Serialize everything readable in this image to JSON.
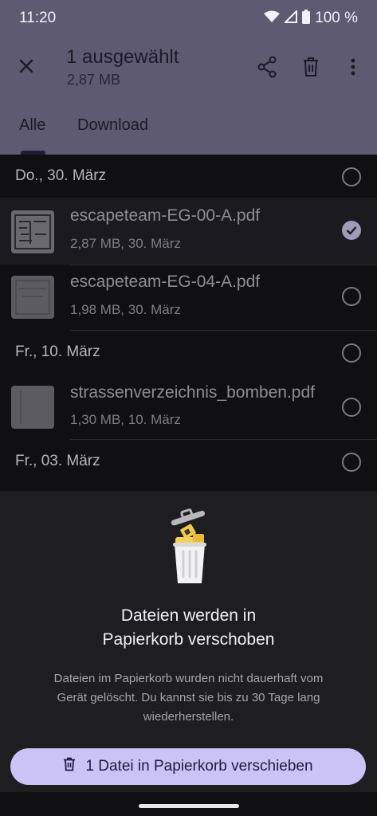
{
  "status_bar": {
    "time": "11:20",
    "battery": "100 %"
  },
  "app_bar": {
    "title": "1 ausgewählt",
    "subtitle": "2,87 MB",
    "close_icon": "close-icon",
    "actions": [
      "share-icon",
      "delete-icon",
      "more-vert-icon"
    ]
  },
  "tabs": [
    {
      "label": "Alle",
      "selected": true
    },
    {
      "label": "Download",
      "selected": false
    }
  ],
  "list": {
    "groups": [
      {
        "date": "Do., 30. März"
      },
      {
        "date": "Fr., 10. März"
      },
      {
        "date": "Fr., 03. März"
      }
    ],
    "files": [
      {
        "name": "escapeteam-EG-00-A.pdf",
        "meta": "2,87 MB, 30. März",
        "selected": true
      },
      {
        "name": "escapeteam-EG-04-A.pdf",
        "meta": "1,98 MB, 30. März",
        "selected": false
      },
      {
        "name": "strassenverzeichnis_bomben.pdf",
        "meta": "1,30 MB, 10. März",
        "selected": false
      }
    ]
  },
  "sheet": {
    "illustration": "trash-can-illustration",
    "title_line1": "Dateien werden in",
    "title_line2": "Papierkorb verschoben",
    "body_line1": "Dateien im Papierkorb wurden nicht dauerhaft vom",
    "body_line2": "Gerät gelöscht. Du kannst sie bis zu 30 Tage lang",
    "body_line3": "wiederherstellen.",
    "button_label": "1 Datei in Papierkorb verschieben",
    "button_icon": "trash-icon"
  },
  "colors": {
    "scrim_top": "#5e5a72",
    "sheet_bg": "#1e1e21",
    "button_bg": "#cbc3f5",
    "button_text": "#1f1a3f"
  }
}
